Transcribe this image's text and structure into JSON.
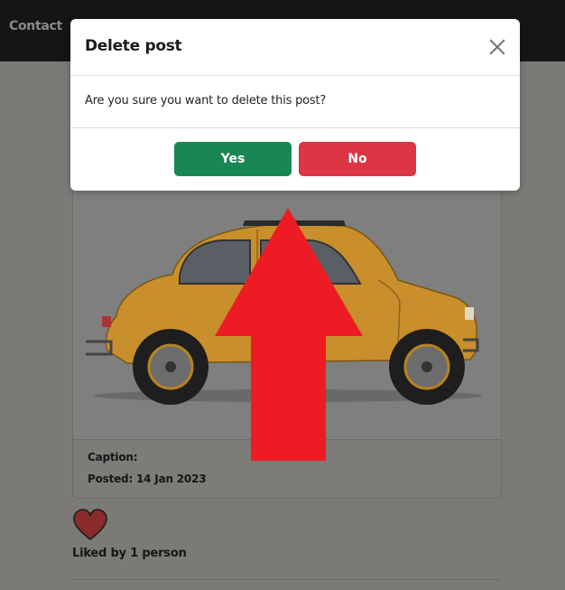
{
  "nav": {
    "contact_label": "Contact"
  },
  "post": {
    "caption_label": "Caption:",
    "posted_label": "Posted: 14 Jan 2023",
    "liked_text": "Liked by 1 person"
  },
  "modal": {
    "title": "Delete post",
    "message": "Are you sure you want to delete this post?",
    "yes_label": "Yes",
    "no_label": "No"
  },
  "colors": {
    "yes": "#198754",
    "no": "#dc3545",
    "heart": "#8b2b2b",
    "arrow": "#ed1c24",
    "car": "#c98f2c"
  }
}
